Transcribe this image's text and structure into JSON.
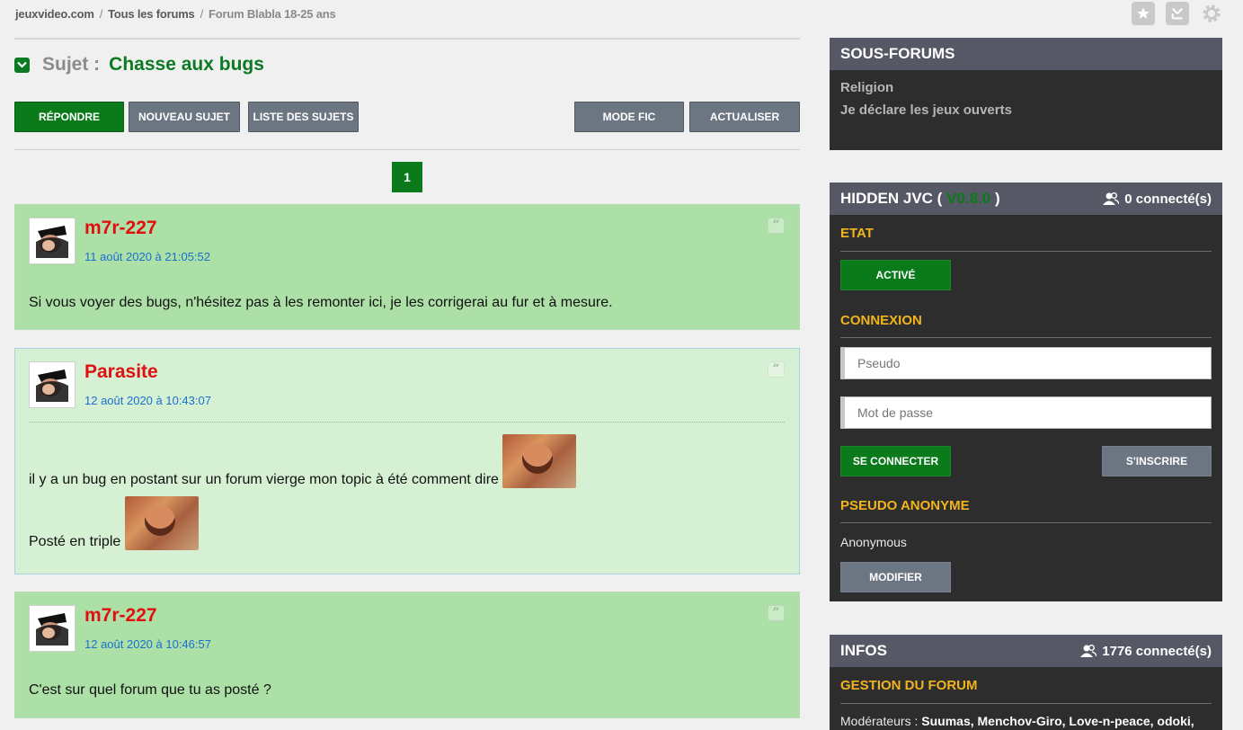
{
  "breadcrumb": {
    "site": "jeuxvideo.com",
    "forums": "Tous les forums",
    "forum": "Forum Blabla 18-25 ans",
    "separator": "/"
  },
  "top_icons": [
    "star-icon",
    "tv-icon",
    "gear-icon"
  ],
  "topic": {
    "label": "Sujet :",
    "title": "Chasse aux bugs"
  },
  "toolbar": {
    "reply": "Répondre",
    "new_topic": "Nouveau sujet",
    "topic_list": "Liste des sujets",
    "fic_mode": "Mode fic",
    "refresh": "Actualiser"
  },
  "pagination": {
    "current": "1"
  },
  "posts": [
    {
      "author": "m7r-227",
      "date": "11 août 2020 à 21:05:52",
      "text": "Si vous voyer des bugs, n'hésitez pas à les remonter ici, je les corrigerai au fur et à mesure."
    },
    {
      "author": "Parasite",
      "date": "12 août 2020 à 10:43:07",
      "text": "il y a un bug en postant sur un forum vierge mon topic à été comment dire",
      "text2": "Posté en triple"
    },
    {
      "author": "m7r-227",
      "date": "12 août 2020 à 10:46:57",
      "text": "C'est sur quel forum que tu as posté ?"
    }
  ],
  "quote_glyph": "”",
  "sidebar": {
    "subforums": {
      "title": "Sous-forums",
      "items": [
        "Religion",
        "Je déclare les jeux ouverts"
      ]
    },
    "hidden": {
      "title_prefix": "HIDDEN JVC (",
      "version": "V0.8.0",
      "title_suffix": ")",
      "connected": "0 connecté(s)",
      "state_title": "ETAT",
      "state_button": "Activé",
      "connection_title": "CONNEXION",
      "pseudo_placeholder": "Pseudo",
      "password_placeholder": "Mot de passe",
      "login_button": "Se connecter",
      "register_button": "S'inscrire",
      "anon_title": "PSEUDO ANONYME",
      "anon_value": "Anonymous",
      "modify_button": "Modifier"
    },
    "infos": {
      "title": "INFOS",
      "connected": "1776 connecté(s)",
      "management_title": "GESTION DU FORUM",
      "moderators_label": "Modérateurs :",
      "moderators": "Suumas, Menchov-Giro, Love-n-peace, odoki,"
    }
  },
  "colors": {
    "accent_green": "#0a7a1a",
    "author_red": "#e01010",
    "date_blue": "#1a6fcf",
    "section_yellow": "#f2b41e",
    "post_dark": "#ace0a7",
    "post_light": "#d5f0d2"
  }
}
